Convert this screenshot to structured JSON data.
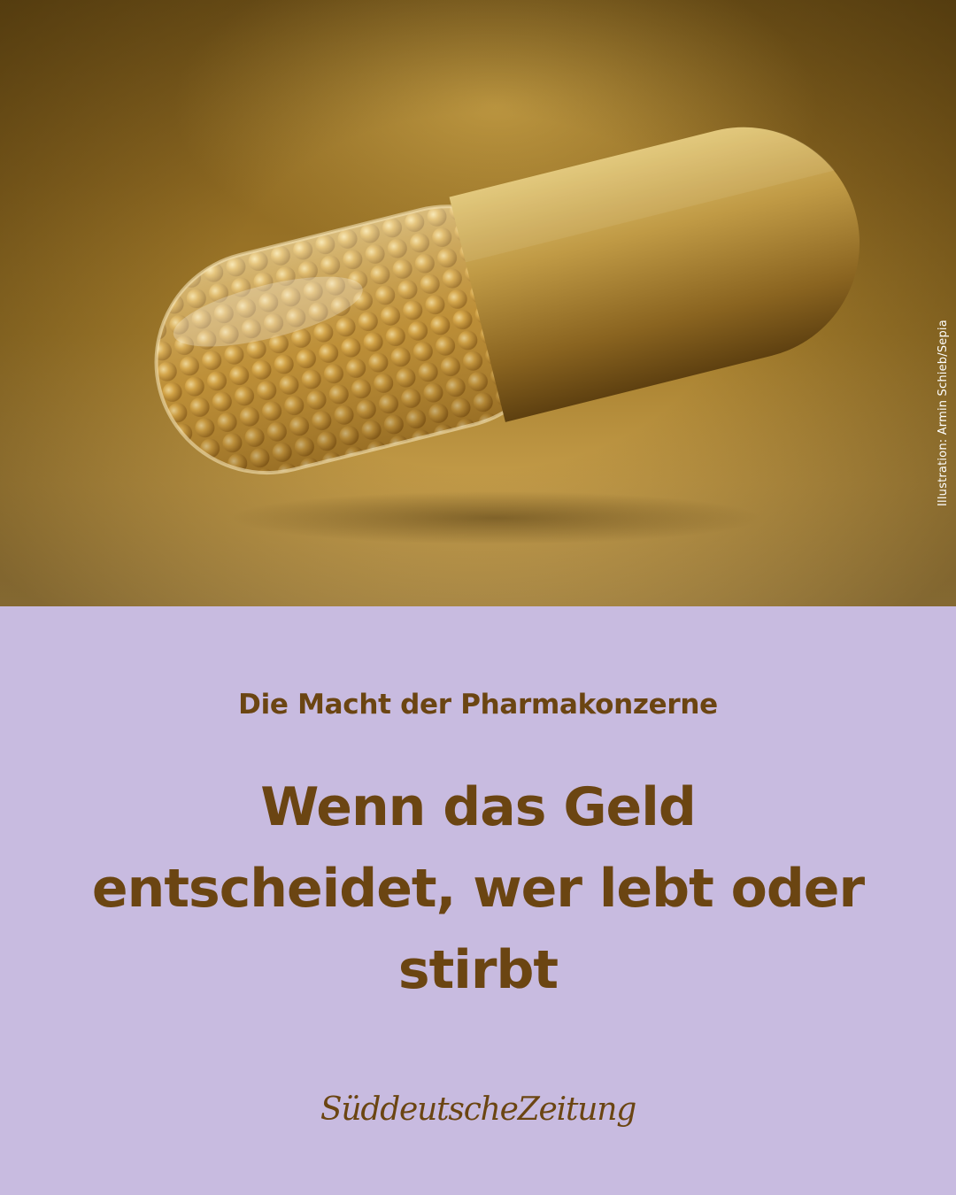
{
  "image": {
    "credit": "Illustration: Armin Schieb/Sepia",
    "subject_icon": "gold-capsule-illustration",
    "background_color": "#9c7629",
    "capsule_color": "#b8953f"
  },
  "article": {
    "kicker": "Die Macht der Pharmakonzerne",
    "headline": "Wenn das Geld entscheidet, wer lebt oder stirbt"
  },
  "brand": {
    "logo_text": "SüddeutscheZeitung"
  },
  "colors": {
    "panel_background": "#c8bbe0",
    "text": "#6b4512"
  }
}
